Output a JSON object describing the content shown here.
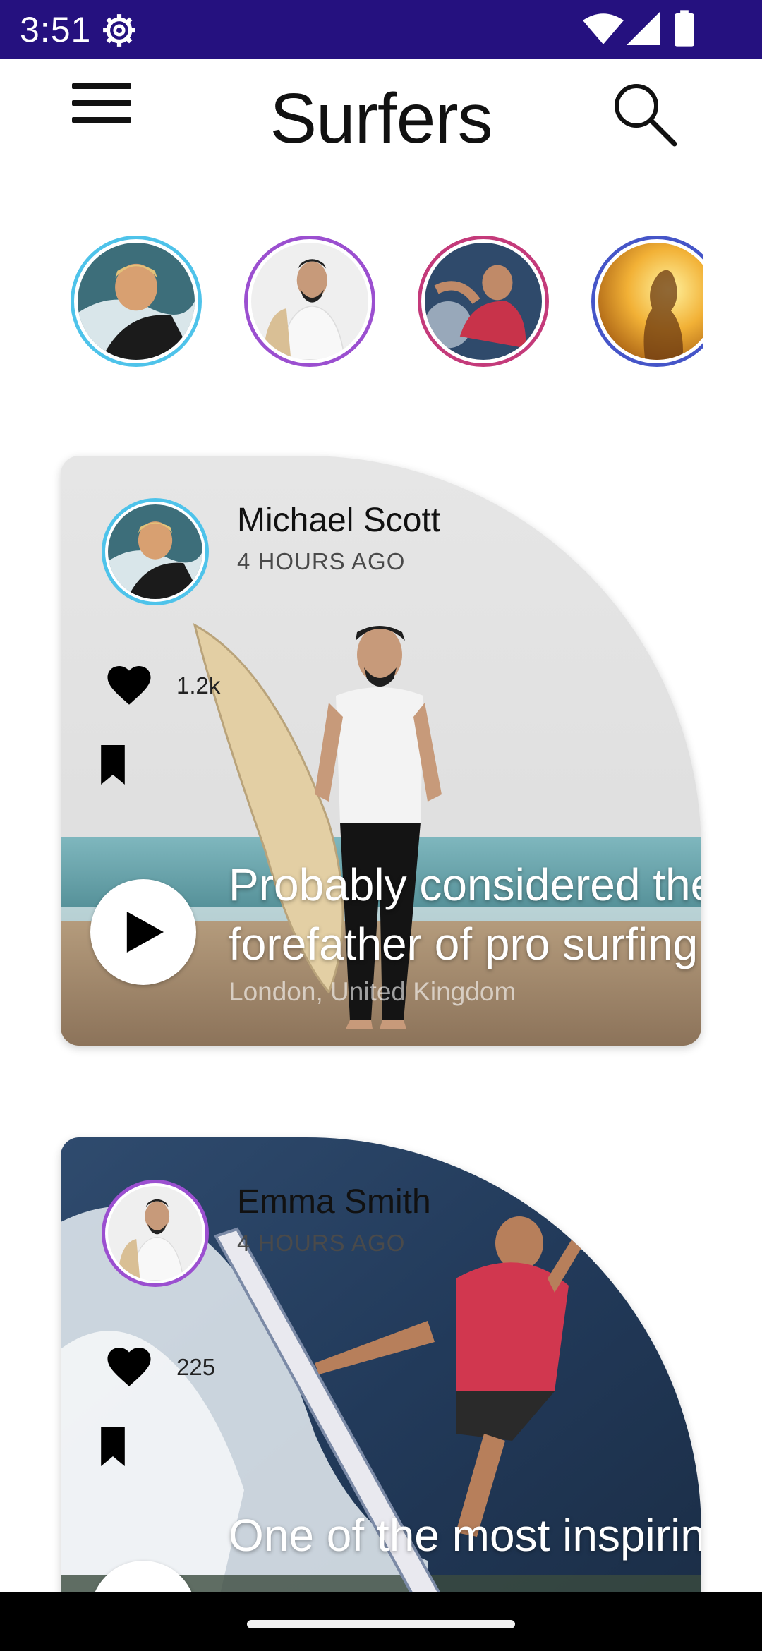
{
  "status_bar": {
    "time": "3:51",
    "background": "#25117f",
    "icons": [
      "settings-gear-icon",
      "wifi-icon",
      "cell-signal-icon",
      "battery-icon"
    ]
  },
  "app_bar": {
    "title": "Surfers",
    "menu_icon": "hamburger-menu-icon",
    "search_icon": "search-icon"
  },
  "stories": [
    {
      "ring_color": "#4ec3ea",
      "image": "surfer-blond-wave-photo"
    },
    {
      "ring_color": "#9b4fd0",
      "image": "surfer-white-tshirt-photo"
    },
    {
      "ring_color": "#c43a7a",
      "image": "surfer-red-shirt-photo"
    },
    {
      "ring_color": "#4555c8",
      "image": "woman-sunset-photo"
    }
  ],
  "posts": [
    {
      "author": "Michael Scott",
      "time_ago": "4 HOURS AGO",
      "avatar_ring_color": "#4ec3ea",
      "likes": "1.2k",
      "caption": "Probably considered the\nforefather of pro surfing",
      "location": "London, United Kingdom",
      "image": "man-holding-surfboard-beach-photo"
    },
    {
      "author": "Emma Smith",
      "time_ago": "4 HOURS AGO",
      "avatar_ring_color": "#9b4fd0",
      "likes": "225",
      "caption": "One of the most inspiring",
      "image": "surfer-riding-wave-photo"
    }
  ],
  "colors": {
    "accent": "#25117f",
    "text": "#111111"
  }
}
